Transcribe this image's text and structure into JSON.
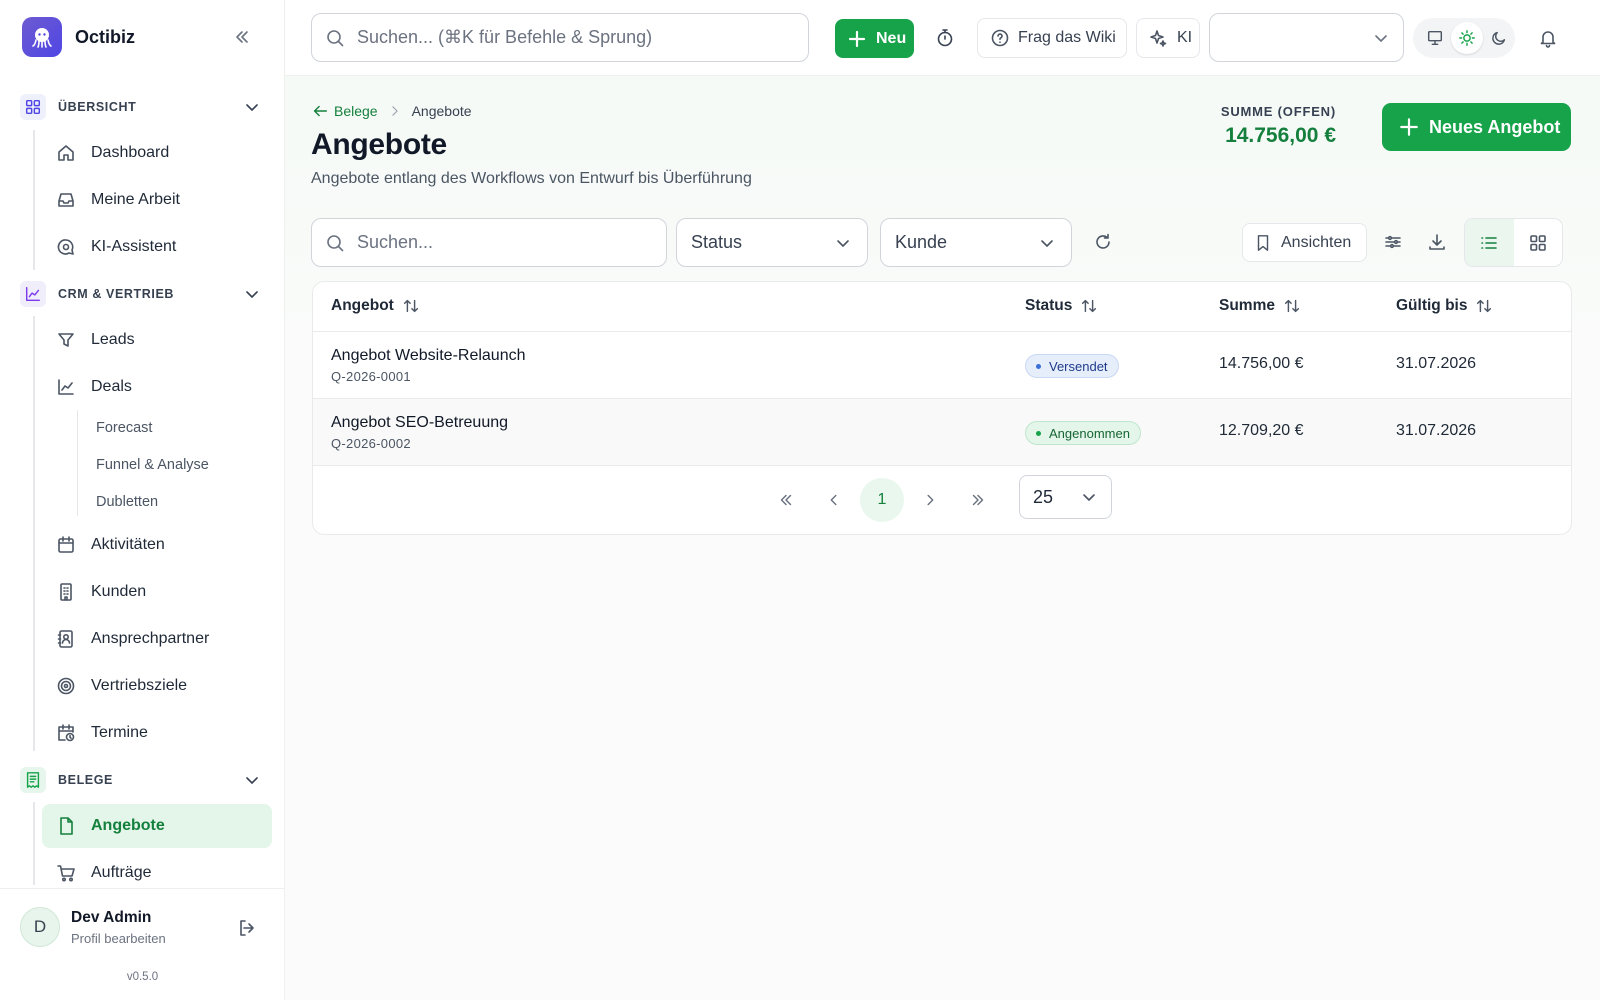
{
  "brand": {
    "name": "Octibiz"
  },
  "sidebar": {
    "sections": [
      {
        "label": "ÜBERSICHT"
      },
      {
        "label": "CRM & VERTRIEB"
      },
      {
        "label": "BELEGE"
      }
    ],
    "items": {
      "dashboard": "Dashboard",
      "my_work": "Meine Arbeit",
      "ai_assistant": "KI-Assistent",
      "leads": "Leads",
      "deals": "Deals",
      "forecast": "Forecast",
      "funnel": "Funnel & Analyse",
      "duplicates": "Dubletten",
      "activities": "Aktivitäten",
      "customers": "Kunden",
      "contacts": "Ansprechpartner",
      "sales_goals": "Vertriebsziele",
      "appointments": "Termine",
      "offers": "Angebote",
      "orders": "Aufträge"
    },
    "user": {
      "initial": "D",
      "name": "Dev Admin",
      "edit": "Profil bearbeiten"
    },
    "version": "v0.5.0"
  },
  "topbar": {
    "search_placeholder": "Suchen... (⌘K für Befehle & Sprung)",
    "new_label": "Neu",
    "wiki_label": "Frag das Wiki",
    "ki_label": "KI",
    "tenant_select_value": ""
  },
  "page": {
    "breadcrumb_back": "Belege",
    "breadcrumb_current": "Angebote",
    "title": "Angebote",
    "subtitle": "Angebote entlang des Workflows von Entwurf bis Überführung",
    "sum_label": "SUMME (OFFEN)",
    "sum_value": "14.756,00 €",
    "new_offer_label": "Neues Angebot"
  },
  "filters": {
    "search_placeholder": "Suchen...",
    "status_label": "Status",
    "customer_label": "Kunde",
    "views_label": "Ansichten"
  },
  "table": {
    "columns": [
      "Angebot",
      "Status",
      "Summe",
      "Gültig bis"
    ],
    "rows": [
      {
        "name": "Angebot Website-Relaunch",
        "number": "Q-2026-0001",
        "status": "Versendet",
        "sum": "14.756,00 €",
        "valid_until": "31.07.2026"
      },
      {
        "name": "Angebot SEO-Betreuung",
        "number": "Q-2026-0002",
        "status": "Angenommen",
        "sum": "12.709,20 €",
        "valid_until": "31.07.2026"
      }
    ]
  },
  "pagination": {
    "current_page": "1",
    "page_size": "25"
  },
  "colors": {
    "accent": "#16a34a",
    "accent_dark": "#15803d",
    "badge_blue": "#3b6fd9"
  },
  "icons": [
    "octopus-logo-icon",
    "collapse-left-icon",
    "grid-icon",
    "home-icon",
    "inbox-icon",
    "chat-search-icon",
    "chart-line-icon",
    "filter-icon",
    "calendar-icon",
    "building-icon",
    "contact-card-icon",
    "target-icon",
    "calendar-clock-icon",
    "receipt-icon",
    "file-icon",
    "cart-icon",
    "logout-icon",
    "search-icon",
    "plus-icon",
    "timer-icon",
    "help-circle-icon",
    "sparkle-icon",
    "chevron-down-icon",
    "monitor-icon",
    "sun-icon",
    "moon-icon",
    "bell-icon",
    "arrow-left-icon",
    "chevron-right-icon",
    "refresh-icon",
    "bookmark-icon",
    "sliders-icon",
    "download-icon",
    "list-icon",
    "sort-icon",
    "chevrons-left-icon",
    "chevron-left-icon",
    "chevrons-right-icon"
  ]
}
